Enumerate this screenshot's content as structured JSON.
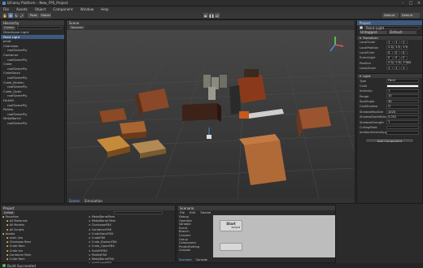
{
  "window": {
    "title": "bFramy Platform – New_FPS_Project"
  },
  "menu": [
    "File",
    "Assets",
    "Object",
    "Component",
    "Window",
    "Help"
  ],
  "toolbar": {
    "pivot_label": "Pivot",
    "global_label": "Global",
    "layout_label": "Default"
  },
  "hierarchy": {
    "title": "Hierarchy",
    "create_label": "Create",
    "items": [
      {
        "label": "Directional Light",
        "indent": 0,
        "selected": false
      },
      {
        "label": "Point Light",
        "indent": 0,
        "selected": true
      },
      {
        "label": "pivot",
        "indent": 0,
        "selected": false
      },
      {
        "label": "Chainsaw",
        "indent": 0,
        "selected": false
      },
      {
        "label": "roofGamePly",
        "indent": 1,
        "selected": false
      },
      {
        "label": "Container",
        "indent": 0,
        "selected": false
      },
      {
        "label": "roofGamePly",
        "indent": 1,
        "selected": false
      },
      {
        "label": "Crate",
        "indent": 0,
        "selected": false
      },
      {
        "label": "roofGamePly",
        "indent": 1,
        "selected": false
      },
      {
        "label": "CrateStack",
        "indent": 0,
        "selected": false
      },
      {
        "label": "roofGamePly",
        "indent": 1,
        "selected": false
      },
      {
        "label": "Crate_Broken",
        "indent": 0,
        "selected": false
      },
      {
        "label": "roofGamePly",
        "indent": 1,
        "selected": false
      },
      {
        "label": "Crate_Open",
        "indent": 0,
        "selected": false
      },
      {
        "label": "roofGamePly",
        "indent": 1,
        "selected": false
      },
      {
        "label": "Forklift",
        "indent": 0,
        "selected": false
      },
      {
        "label": "roofGamePly",
        "indent": 1,
        "selected": false
      },
      {
        "label": "Pallets",
        "indent": 0,
        "selected": false
      },
      {
        "label": "roofGamePly",
        "indent": 1,
        "selected": false
      },
      {
        "label": "MetalBarrel",
        "indent": 0,
        "selected": false
      },
      {
        "label": "roofGamePly",
        "indent": 1,
        "selected": false
      }
    ]
  },
  "scene": {
    "title": "Scene",
    "view_mode": "Textured",
    "tabs": [
      "Scene",
      "Simulation"
    ]
  },
  "inspector": {
    "tab_label": "Project",
    "object_name": "Point Light",
    "tag_label": "Untagged",
    "layer_label": "Default",
    "transform": {
      "title": "Transform",
      "rows": [
        {
          "label": "LocalScale",
          "values": [
            "1",
            "1",
            "1"
          ]
        },
        {
          "label": "LocalPosition",
          "values": [
            "2.2734",
            "1.5",
            "1.9"
          ]
        },
        {
          "label": "LocalEuler",
          "values": [
            "0",
            "0",
            "0"
          ]
        },
        {
          "label": "EulerAngle",
          "values": [
            "0",
            "0",
            "0"
          ]
        },
        {
          "label": "Position",
          "values": [
            "2.2734",
            "1.5718",
            "1.905"
          ]
        },
        {
          "label": "LossyScale",
          "values": [
            "1",
            "1",
            "1"
          ]
        }
      ]
    },
    "light": {
      "title": "Light",
      "rows": [
        {
          "label": "Type",
          "value": "Point"
        },
        {
          "label": "Color",
          "value": ""
        },
        {
          "label": "Intensity",
          "value": "1"
        },
        {
          "label": "Range",
          "value": "10"
        },
        {
          "label": "SpotAngle",
          "value": "30"
        },
        {
          "label": "CastShadow",
          "value": "☐"
        },
        {
          "label": "ShadowMapSize",
          "value": "1024"
        },
        {
          "label": "ShadowDepthBias",
          "value": "0.001"
        },
        {
          "label": "ShadowStrength",
          "value": "1"
        },
        {
          "label": "CullingMask",
          "value": ""
        },
        {
          "label": "ambientIntensity.gh",
          "value": ""
        }
      ]
    },
    "add_component_label": "Add Component"
  },
  "project": {
    "title": "Project",
    "create_label": "Create",
    "folders": [
      {
        "label": "Favorites",
        "indent": 0
      },
      {
        "label": "All Materials",
        "indent": 1
      },
      {
        "label": "All Models",
        "indent": 1
      },
      {
        "label": "All Scripts",
        "indent": 1
      },
      {
        "label": "Assets",
        "indent": 0
      },
      {
        "label": "anim line",
        "indent": 1
      },
      {
        "label": "Chainsaw Rem",
        "indent": 1
      },
      {
        "label": "Crate Rem",
        "indent": 1
      },
      {
        "label": "Crate bin",
        "indent": 1
      },
      {
        "label": "Container Rem",
        "indent": 1
      },
      {
        "label": "Crate Rem",
        "indent": 1
      }
    ],
    "files": [
      "MetalBarrelRem",
      "MetalBarrel.Rem",
      "ChainsawFBX",
      "ContainerFBX",
      "CrateStackFBX",
      "CrateFBX",
      "Crate_BrokenFBX",
      "Crate_OpenFBX",
      "ForkliftFBX",
      "PalletsFBX",
      "MetalBarrelFBX",
      "roofGameFBX"
    ]
  },
  "script": {
    "title": "Scenario",
    "menu": [
      "File",
      "Edit",
      "Tutorial"
    ],
    "nodes": [
      "Debug",
      "Operator",
      "Variable",
      "Event",
      "Branch",
      "Convert",
      "Group",
      "Component",
      "ProjectSetting",
      "Console"
    ],
    "start_node": {
      "title": "Start",
      "port": "output"
    },
    "tabs": [
      "Scenario",
      "Console"
    ]
  },
  "status": {
    "text": "Build Succeeded"
  }
}
